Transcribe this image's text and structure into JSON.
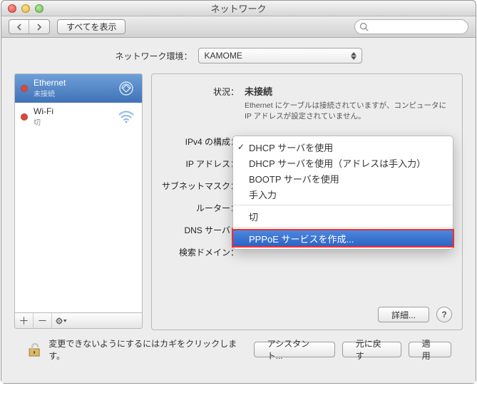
{
  "window": {
    "title": "ネットワーク"
  },
  "toolbar": {
    "show_all": "すべてを表示",
    "search_placeholder": ""
  },
  "env": {
    "label": "ネットワーク環境：",
    "value": "KAMOME"
  },
  "sidebar": {
    "items": [
      {
        "name": "Ethernet",
        "status": "未接続",
        "selected": true,
        "icon": "ethernet-arrows-icon"
      },
      {
        "name": "Wi-Fi",
        "status": "切",
        "selected": false,
        "icon": "wifi-icon"
      }
    ]
  },
  "panel": {
    "status_label": "状況：",
    "status_value": "未接続",
    "status_desc": "Ethernet にケーブルは接続されていますが、コンピュータに IP アドレスが設定されていません。",
    "fields": {
      "ipv4_config": "IPv4 の構成：",
      "ip_address": "IP アドレス：",
      "subnet_mask": "サブネットマスク：",
      "router": "ルーター：",
      "dns_server": "DNS サーバ：",
      "search_domain": "検索ドメイン："
    },
    "advanced": "詳細..."
  },
  "menu": {
    "items": [
      {
        "label": "DHCP サーバを使用",
        "checked": true
      },
      {
        "label": "DHCP サーバを使用（アドレスは手入力）",
        "checked": false
      },
      {
        "label": "BOOTP サーバを使用",
        "checked": false
      },
      {
        "label": "手入力",
        "checked": false
      }
    ],
    "off": "切",
    "pppoe": "PPPoE サービスを作成..."
  },
  "footer": {
    "lock_text": "変更できないようにするにはカギをクリックします。",
    "assistant": "アシスタント...",
    "revert": "元に戻す",
    "apply": "適用"
  }
}
